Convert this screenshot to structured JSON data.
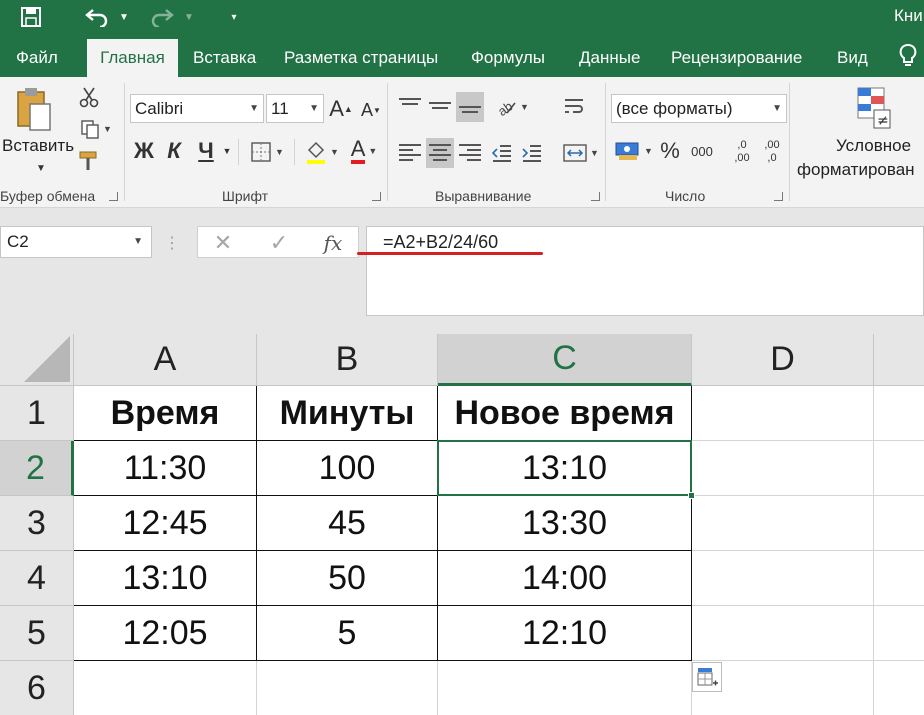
{
  "title_bar": {
    "save_icon": "save-icon",
    "undo_icon": "undo-icon",
    "redo_icon": "redo-icon",
    "customize_icon": "customize-quick-access-icon",
    "doc_title": "Кни"
  },
  "tabs": [
    "Файл",
    "Главная",
    "Вставка",
    "Разметка страницы",
    "Формулы",
    "Данные",
    "Рецензирование",
    "Вид"
  ],
  "active_tab": "Главная",
  "ribbon": {
    "clipboard": {
      "paste_label": "Вставить",
      "group_label": "Буфер обмена"
    },
    "font": {
      "font_name": "Calibri",
      "font_size": "11",
      "bold_label": "Ж",
      "italic_label": "К",
      "underline_label": "Ч",
      "font_color_label": "A",
      "grow_label": "A",
      "shrink_label": "A",
      "group_label": "Шрифт"
    },
    "alignment": {
      "group_label": "Выравнивание"
    },
    "number": {
      "format": "(все форматы)",
      "percent_label": "%",
      "thousands_label": "000",
      "inc_decimal_label": ",0 ,00",
      "dec_decimal_label": ",00 ,0",
      "group_label": "Число"
    },
    "styles": {
      "conditional_line1": "Условное",
      "conditional_line2": "форматирован"
    }
  },
  "formula_bar": {
    "name_box": "C2",
    "cancel_label": "✕",
    "enter_label": "✓",
    "fx_label": "fx",
    "formula": "=A2+B2/24/60"
  },
  "grid": {
    "columns": [
      "A",
      "B",
      "C",
      "D"
    ],
    "rows": [
      "1",
      "2",
      "3",
      "4",
      "5",
      "6"
    ],
    "selected_cell": "C2",
    "headers": [
      "Время",
      "Минуты",
      "Новое время"
    ],
    "data": [
      [
        "11:30",
        "100",
        "13:10"
      ],
      [
        "12:45",
        "45",
        "13:30"
      ],
      [
        "13:10",
        "50",
        "14:00"
      ],
      [
        "12:05",
        "5",
        "12:10"
      ]
    ]
  },
  "colors": {
    "excel_green": "#217346",
    "annotation_red": "#d32020"
  }
}
